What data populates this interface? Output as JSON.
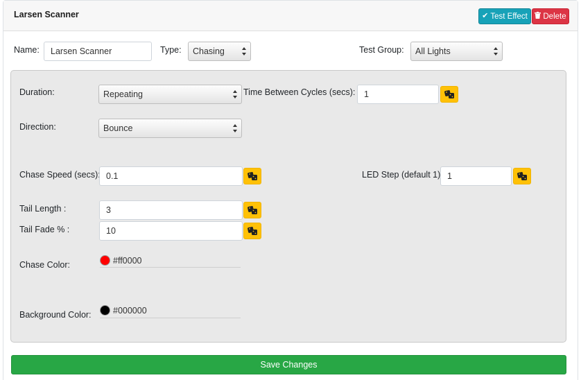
{
  "header": {
    "title": "Larsen Scanner",
    "test_effect_label": "Test Effect",
    "delete_label": "Delete"
  },
  "top_row": {
    "name_label": "Name:",
    "name_value": "Larsen Scanner",
    "type_label": "Type:",
    "type_value": "Chasing",
    "test_group_label": "Test Group:",
    "test_group_value": "All Lights"
  },
  "panel": {
    "duration_label": "Duration:",
    "duration_value": "Repeating",
    "time_between_label": "Time Between Cycles (secs):",
    "time_between_value": "1",
    "direction_label": "Direction:",
    "direction_value": "Bounce",
    "chase_speed_label": "Chase Speed (secs):",
    "chase_speed_value": "0.1",
    "led_step_label": "LED Step (default 1):",
    "led_step_value": "1",
    "tail_length_label": "Tail Length :",
    "tail_length_value": "3",
    "tail_fade_label": "Tail Fade % :",
    "tail_fade_value": "10",
    "chase_color_label": "Chase Color:",
    "chase_color_value": "#ff0000",
    "background_color_label": "Background Color:",
    "background_color_value": "#000000"
  },
  "colors": {
    "info": "#17a2b8",
    "danger": "#dc3545",
    "warning": "#ffc107",
    "success": "#28a745",
    "chase_swatch": "#ff0000",
    "background_swatch": "#000000"
  },
  "icons": {
    "test_effect": "check-icon",
    "delete": "trash-icon",
    "randomize": "dice-icon"
  },
  "footer": {
    "save_label": "Save Changes"
  }
}
